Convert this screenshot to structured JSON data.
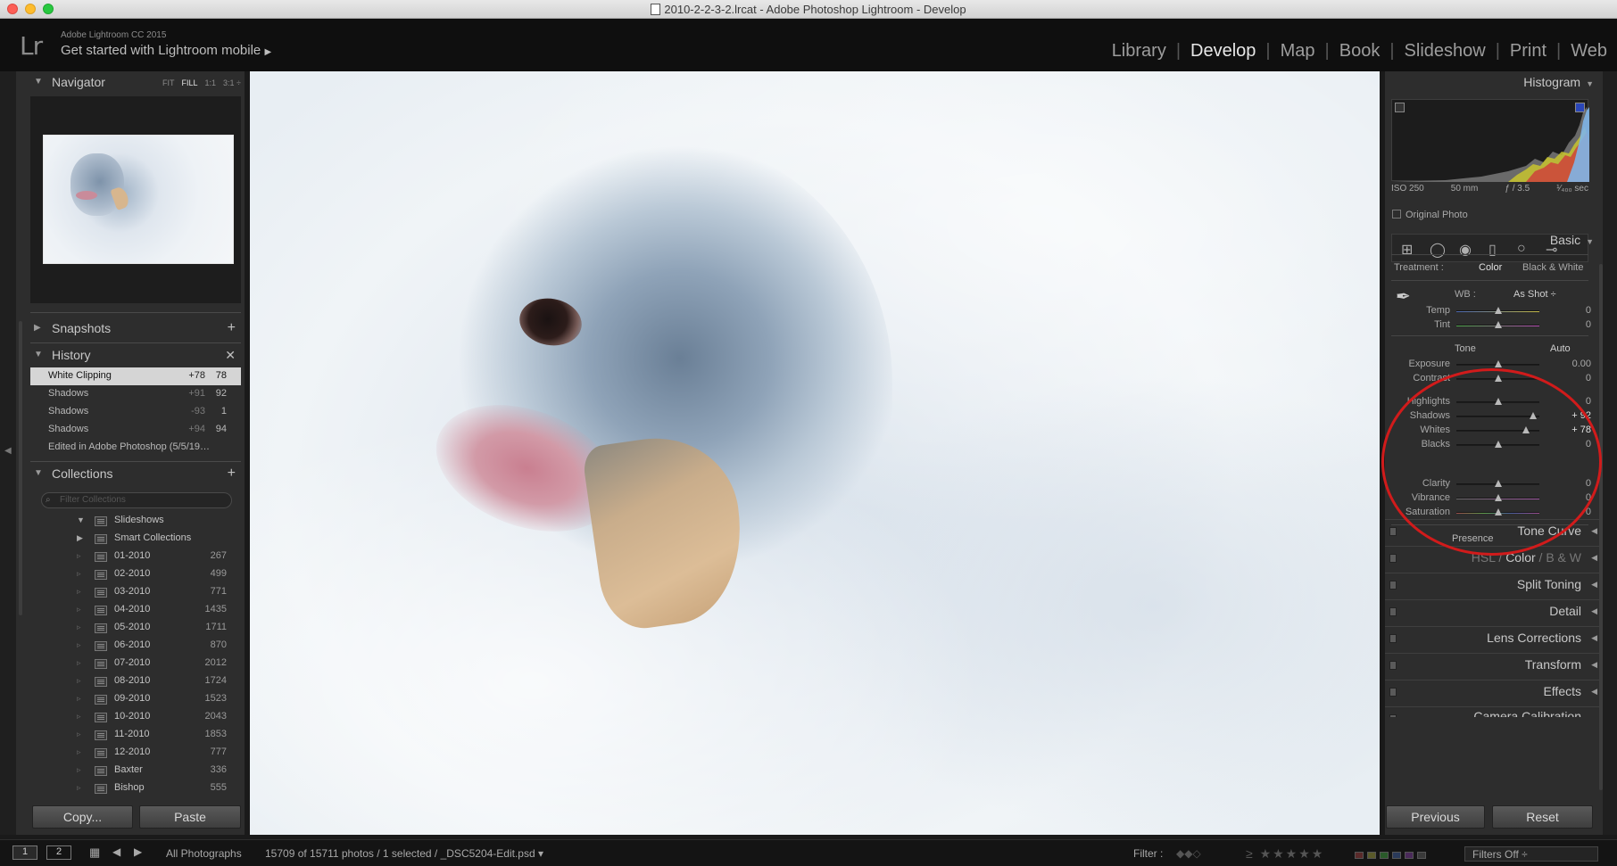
{
  "window": {
    "title": "2010-2-2-3-2.lrcat - Adobe Photoshop Lightroom - Develop"
  },
  "identity": {
    "logo": "Lr",
    "app_name": "Adobe Lightroom CC 2015",
    "mobile_prompt": "Get started with Lightroom mobile",
    "mobile_arrow": "▶"
  },
  "modules": [
    "Library",
    "Develop",
    "Map",
    "Book",
    "Slideshow",
    "Print",
    "Web"
  ],
  "active_module": "Develop",
  "navigator": {
    "title": "Navigator",
    "options": [
      "FIT",
      "FILL",
      "1:1",
      "3:1 ÷"
    ],
    "active_option": "FILL"
  },
  "snapshots": {
    "title": "Snapshots"
  },
  "history": {
    "title": "History",
    "items": [
      {
        "name": "White Clipping",
        "delta": "+78",
        "value": "78",
        "selected": true
      },
      {
        "name": "Shadows",
        "delta": "+91",
        "value": "92"
      },
      {
        "name": "Shadows",
        "delta": "-93",
        "value": "1"
      },
      {
        "name": "Shadows",
        "delta": "+94",
        "value": "94"
      },
      {
        "name": "Edited in Adobe Photoshop (5/5/19…",
        "delta": "",
        "value": ""
      }
    ]
  },
  "collections": {
    "title": "Collections",
    "search_placeholder": "Filter Collections",
    "items": [
      {
        "name": "Slideshows",
        "count": "",
        "expand": "▼"
      },
      {
        "name": "Smart Collections",
        "count": "",
        "expand": "▶"
      },
      {
        "name": "01-2010",
        "count": "267"
      },
      {
        "name": "02-2010",
        "count": "499"
      },
      {
        "name": "03-2010",
        "count": "771"
      },
      {
        "name": "04-2010",
        "count": "1435"
      },
      {
        "name": "05-2010",
        "count": "1711"
      },
      {
        "name": "06-2010",
        "count": "870"
      },
      {
        "name": "07-2010",
        "count": "2012"
      },
      {
        "name": "08-2010",
        "count": "1724"
      },
      {
        "name": "09-2010",
        "count": "1523"
      },
      {
        "name": "10-2010",
        "count": "2043"
      },
      {
        "name": "11-2010",
        "count": "1853"
      },
      {
        "name": "12-2010",
        "count": "777"
      },
      {
        "name": "Baxter",
        "count": "336"
      },
      {
        "name": "Bishop",
        "count": "555"
      }
    ]
  },
  "left_footer": {
    "copy": "Copy...",
    "paste": "Paste"
  },
  "histogram": {
    "title": "Histogram",
    "iso": "ISO 250",
    "focal": "50 mm",
    "aperture": "ƒ / 3.5",
    "shutter": "¹⁄₄₀₀ sec",
    "original_photo": "Original Photo"
  },
  "basic": {
    "title": "Basic",
    "treatment_label": "Treatment :",
    "treatment_color": "Color",
    "treatment_bw": "Black & White",
    "wb_label": "WB :",
    "wb_value": "As Shot ÷",
    "tone_label": "Tone",
    "auto": "Auto",
    "presence_label": "Presence",
    "sliders": {
      "temp": {
        "label": "Temp",
        "value": "0",
        "pos": 0.5
      },
      "tint": {
        "label": "Tint",
        "value": "0",
        "pos": 0.5
      },
      "exposure": {
        "label": "Exposure",
        "value": "0.00",
        "pos": 0.5
      },
      "contrast": {
        "label": "Contrast",
        "value": "0",
        "pos": 0.5
      },
      "highlights": {
        "label": "Highlights",
        "value": "0",
        "pos": 0.5
      },
      "shadows": {
        "label": "Shadows",
        "value": "+ 92",
        "pos": 0.92
      },
      "whites": {
        "label": "Whites",
        "value": "+ 78",
        "pos": 0.84
      },
      "blacks": {
        "label": "Blacks",
        "value": "0",
        "pos": 0.5
      },
      "clarity": {
        "label": "Clarity",
        "value": "0",
        "pos": 0.5
      },
      "vibrance": {
        "label": "Vibrance",
        "value": "0",
        "pos": 0.5
      },
      "saturation": {
        "label": "Saturation",
        "value": "0",
        "pos": 0.5
      }
    }
  },
  "sections": {
    "tone_curve": "Tone Curve",
    "hsl": "HSL",
    "hsl_sep1": "/",
    "hsl_color": "Color",
    "hsl_sep2": "/",
    "hsl_bw": "B & W",
    "split_toning": "Split Toning",
    "detail": "Detail",
    "lens": "Lens Corrections",
    "transform": "Transform",
    "effects": "Effects",
    "camera_calibration": "Camera Calibration"
  },
  "right_footer": {
    "previous": "Previous",
    "reset": "Reset"
  },
  "filmstrip": {
    "page1": "1",
    "page2": "2",
    "source": "All Photographs",
    "status": "15709 of 15711 photos / 1 selected / _DSC5204-Edit.psd ▾",
    "filter_label": "Filter :",
    "stars": "≥ ★★★★★",
    "filters_off": "Filters Off ÷"
  },
  "colors": {
    "accent_ring": "#d11b1b",
    "clip_highlight": "#2a46b8",
    "panel_bg": "#2d2d2d"
  }
}
